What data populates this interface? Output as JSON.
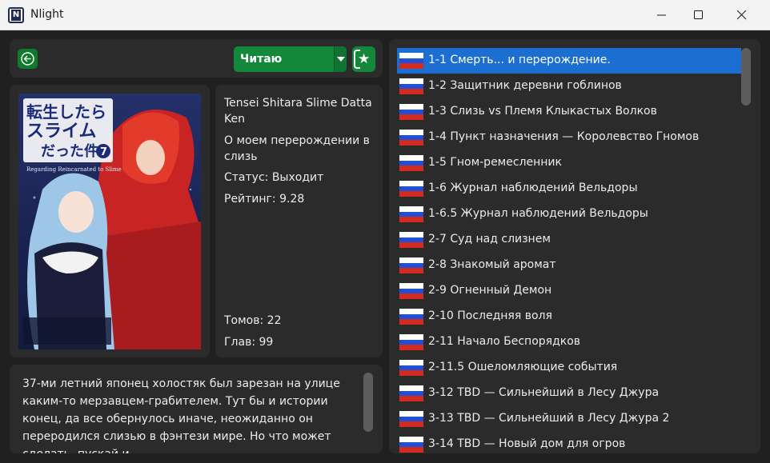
{
  "window": {
    "title": "Nlight",
    "icon_letter": "N"
  },
  "toolbar": {
    "status_label": "Читаю"
  },
  "manga": {
    "title_en": "Tensei Shitara Slime Datta Ken",
    "title_ru": "О моем перерождении в слизь",
    "status": "Статус: Выходит",
    "rating": "Рейтинг: 9.28",
    "volumes": "Томов: 22",
    "chapters": "Глав: 99",
    "cover_text": {
      "jp_title_line1": "転生したら",
      "jp_title_line2": "スライム",
      "jp_title_line3": "だった件",
      "volume": "7",
      "en_subtitle": "Regarding Reincarnated to Slime"
    }
  },
  "description": "37-ми летний японец холостяк был зарезан на улице каким-то мерзавцем-грабителем. Тут бы и истории конец, да все обернулось иначе, неожиданно он переродился слизью в фэнтези мире. Но что может сделать, пускай и",
  "chapter_list": [
    "1-1 Смерть... и перерождение.",
    "1-2 Защитник деревни гоблинов",
    "1-3 Слизь vs Племя Клыкастых Волков",
    "1-4 Пункт назначения — Королевство Гномов",
    "1-5 Гном-ремесленник",
    "1-6 Журнал наблюдений Вельдоры",
    "1-6.5 Журнал наблюдений Вельдоры",
    "2-7 Суд над слизнем",
    "2-8 Знакомый аромат",
    "2-9 Огненный Демон",
    "2-10 Последняя воля",
    "2-11 Начало Беспорядков",
    "2-11.5 Ошеломляющие события",
    "3-12 TBD — Сильнейший в Лесу Джура",
    "3-13 TBD — Сильнейший в Лесу Джура 2",
    "3-14 TBD — Новый дом для огров"
  ],
  "selected_chapter_index": 0
}
